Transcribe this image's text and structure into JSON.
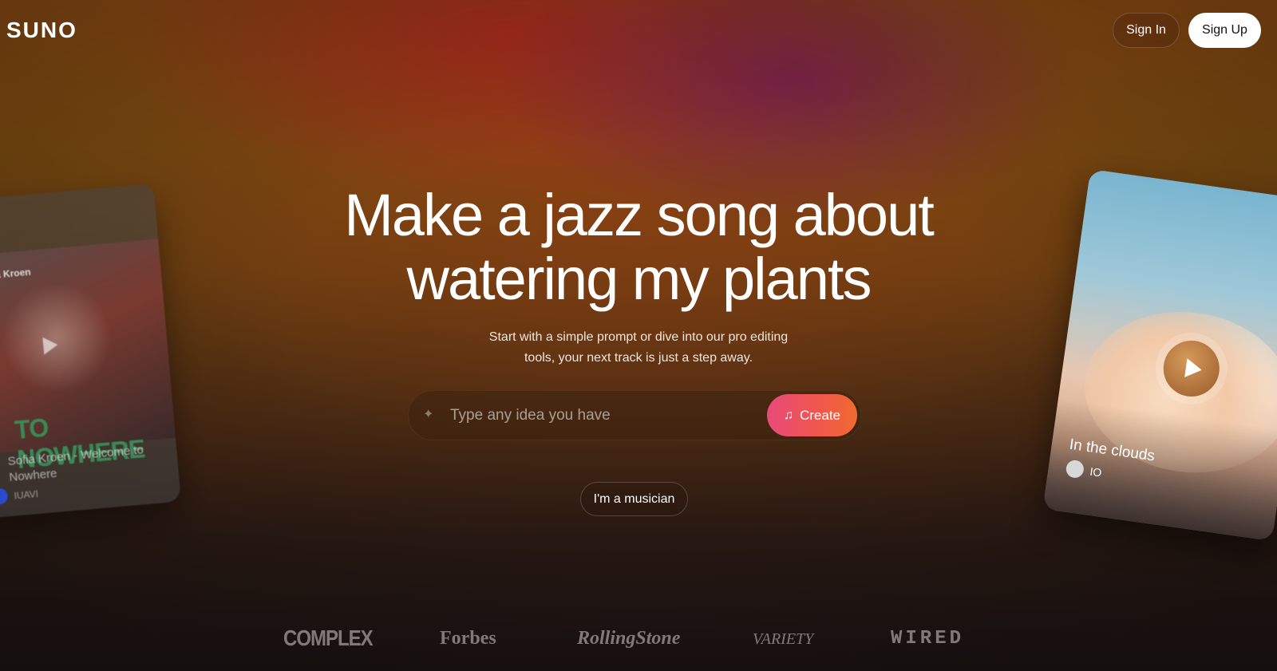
{
  "header": {
    "logo": "SUNO",
    "sign_in": "Sign In",
    "sign_up": "Sign Up"
  },
  "hero": {
    "headline_line1": "Make a jazz song about",
    "headline_line2": "watering my plants",
    "subtitle_line1": "Start with a simple prompt or dive into our pro editing",
    "subtitle_line2": "tools, your next track is just a step away."
  },
  "prompt": {
    "placeholder": "Type any idea you have",
    "value": "",
    "sparkle_icon": "sparkle-icon",
    "create_label": "Create",
    "create_icon": "music-note-icon",
    "accent_gradient": [
      "#e84a7a",
      "#f06a30"
    ]
  },
  "musician_button": "I'm a musician",
  "cards": {
    "left": {
      "art_label": "Sofia Kroen",
      "art_text": "TO NOWHERE",
      "title": "Sofia Kroen - Welcome to Nowhere",
      "user": "IUAVI"
    },
    "right": {
      "title": "In the clouds",
      "user": "IO"
    }
  },
  "press": [
    "COMPLEX",
    "Forbes",
    "RollingStone",
    "VARIETY",
    "WIRED"
  ]
}
